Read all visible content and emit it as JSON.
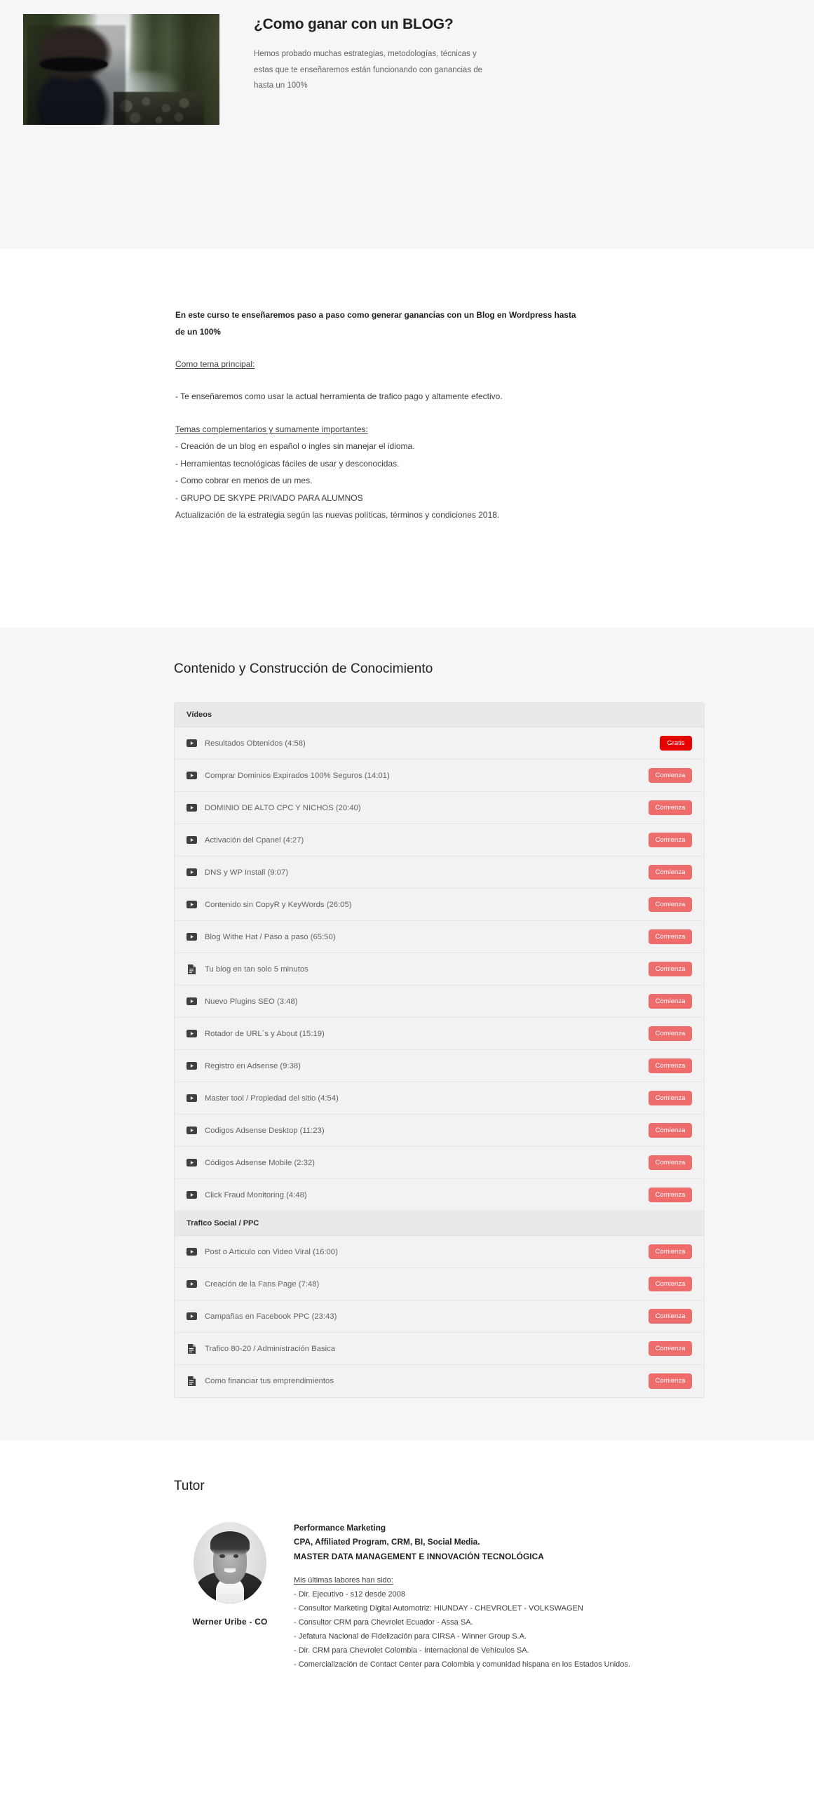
{
  "hero": {
    "title": "¿Como ganar con un BLOG?",
    "description": "Hemos probado muchas estrategias, metodologías, técnicas y estas que te enseñaremos están funcionando con ganancias de hasta un 100%",
    "video_thumbnail_alt": "video-thumbnail"
  },
  "description_section": {
    "lead": "En este curso te enseñaremos paso a paso como generar ganancias con un Blog en Wordpress hasta de un 100%",
    "main_topic_heading": "Como tema principal:",
    "main_topic_item": "- Te enseñaremos como usar la actual herramienta de trafico pago y altamente efectivo.",
    "complementary_heading": "Temas complementarios y sumamente importantes:",
    "complementary_items": [
      "- Creación de un blog en español o ingles sin manejar el idioma.",
      "- Herramientas tecnológicas fáciles de usar y desconocidas.",
      "- Como cobrar en menos de un mes.",
      "- GRUPO DE SKYPE PRIVADO PARA ALUMNOS",
      "Actualización de la estrategia según las nuevas políticas, términos y condiciones 2018."
    ]
  },
  "curriculum": {
    "title": "Contenido y Construcción de Conocimiento",
    "sections": [
      {
        "header": "Vídeos",
        "items": [
          {
            "icon": "play-icon",
            "label": "Resultados Obtenidos (4:58)",
            "button": "Gratis",
            "button_type": "free"
          },
          {
            "icon": "play-icon",
            "label": "Comprar Dominios Expirados 100% Seguros (14:01)",
            "button": "Comienza",
            "button_type": "start"
          },
          {
            "icon": "play-icon",
            "label": "DOMINIO DE ALTO CPC Y NICHOS (20:40)",
            "button": "Comienza",
            "button_type": "start"
          },
          {
            "icon": "play-icon",
            "label": "Activación del Cpanel (4:27)",
            "button": "Comienza",
            "button_type": "start"
          },
          {
            "icon": "play-icon",
            "label": "DNS y WP Install (9:07)",
            "button": "Comienza",
            "button_type": "start"
          },
          {
            "icon": "play-icon",
            "label": "Contenido sin CopyR y KeyWords (26:05)",
            "button": "Comienza",
            "button_type": "start"
          },
          {
            "icon": "play-icon",
            "label": "Blog Withe Hat / Paso a paso (65:50)",
            "button": "Comienza",
            "button_type": "start"
          },
          {
            "icon": "document-icon",
            "label": "Tu blog en tan solo 5 minutos",
            "button": "Comienza",
            "button_type": "start"
          },
          {
            "icon": "play-icon",
            "label": "Nuevo Plugins SEO (3:48)",
            "button": "Comienza",
            "button_type": "start"
          },
          {
            "icon": "play-icon",
            "label": "Rotador de URL´s y About (15:19)",
            "button": "Comienza",
            "button_type": "start"
          },
          {
            "icon": "play-icon",
            "label": "Registro en Adsense (9:38)",
            "button": "Comienza",
            "button_type": "start"
          },
          {
            "icon": "play-icon",
            "label": "Master tool / Propiedad del sitio (4:54)",
            "button": "Comienza",
            "button_type": "start"
          },
          {
            "icon": "play-icon",
            "label": "Codigos Adsense Desktop (11:23)",
            "button": "Comienza",
            "button_type": "start"
          },
          {
            "icon": "play-icon",
            "label": "Códigos Adsense Mobile (2:32)",
            "button": "Comienza",
            "button_type": "start"
          },
          {
            "icon": "play-icon",
            "label": "Click Fraud Monitoring (4:48)",
            "button": "Comienza",
            "button_type": "start"
          }
        ]
      },
      {
        "header": "Trafico Social / PPC",
        "items": [
          {
            "icon": "play-icon",
            "label": "Post o Articulo con Video Viral (16:00)",
            "button": "Comienza",
            "button_type": "start"
          },
          {
            "icon": "play-icon",
            "label": "Creación de la Fans Page (7:48)",
            "button": "Comienza",
            "button_type": "start"
          },
          {
            "icon": "play-icon",
            "label": "Campañas en Facebook PPC (23:43)",
            "button": "Comienza",
            "button_type": "start"
          },
          {
            "icon": "document-icon",
            "label": "Trafico 80-20 / Administración Basica",
            "button": "Comienza",
            "button_type": "start"
          },
          {
            "icon": "document-icon",
            "label": "Como financiar tus emprendimientos",
            "button": "Comienza",
            "button_type": "start"
          }
        ]
      }
    ]
  },
  "tutor": {
    "title": "Tutor",
    "name": "Werner Uribe - CO",
    "avatar_alt": "tutor-portrait",
    "headings": [
      "Performance Marketing",
      "CPA, Affiliated Program, CRM, BI, Social Media.",
      "MASTER DATA MANAGEMENT E INNOVACIÓN TECNOLÓGICA"
    ],
    "experience_heading": "Mis últimas labores han sido:",
    "experience_items": [
      "- Dir. Ejecutivo - s12 desde 2008",
      "- Consultor Marketing Digital Automotriz: HIUNDAY - CHEVROLET - VOLKSWAGEN",
      "- Consultor CRM para Chevrolet Ecuador - Assa SA.",
      "- Jefatura Nacional de Fidelización para CIRSA - Winner Group S.A.",
      "- Dir. CRM para Chevrolet Colombia - Internacional de Vehículos SA.",
      "- Comercialización de Contact Center para Colombia y comunidad hispana en los Estados Unidos."
    ]
  },
  "colors": {
    "page_bg": "#ffffff",
    "section_bg": "#f6f6f6",
    "panel_bg": "#f2f2f2",
    "panel_header_bg": "#e9e9e9",
    "btn_start": "#ef6c6c",
    "btn_free": "#e60000",
    "text_primary": "#202124",
    "text_secondary": "#5f6368"
  }
}
